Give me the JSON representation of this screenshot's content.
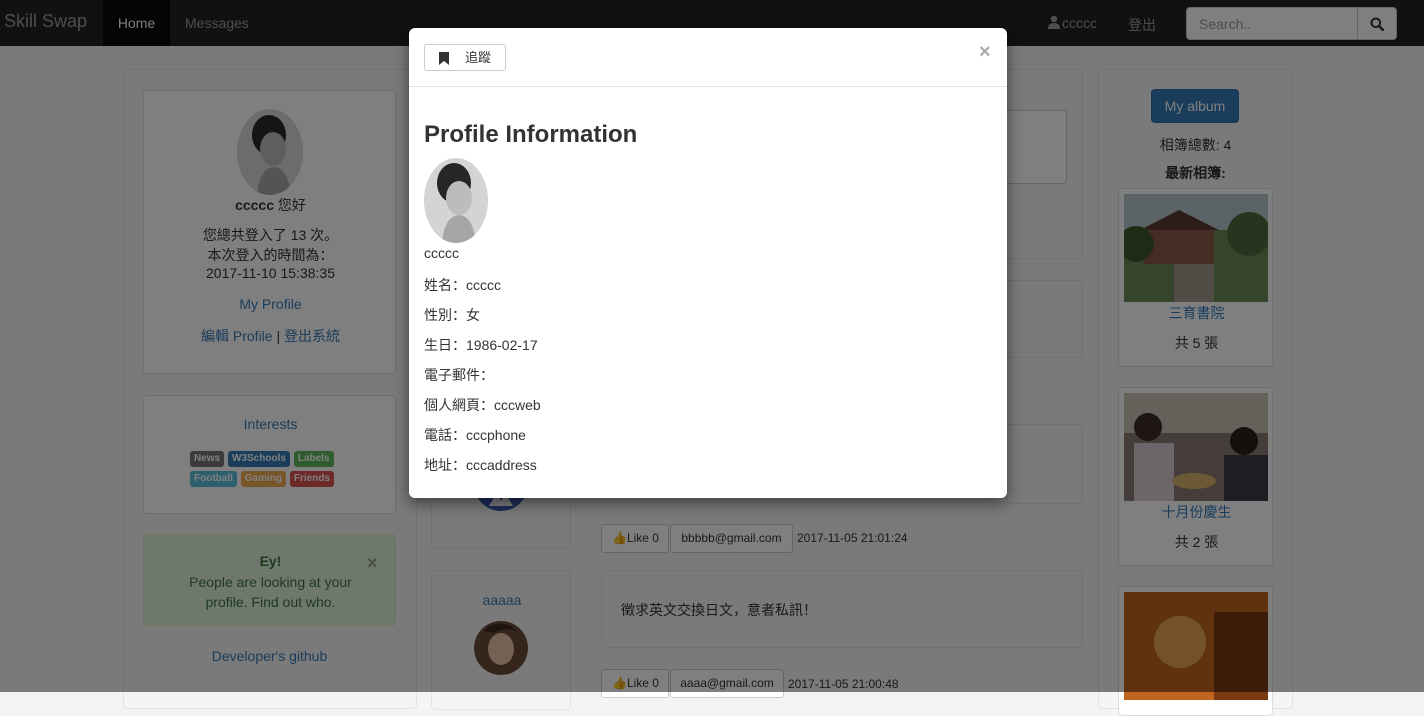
{
  "navbar": {
    "brand": "Skill Swap",
    "home": "Home",
    "messages": "Messages",
    "user": "ccccc",
    "logout": "登出",
    "search_placeholder": "Search.."
  },
  "left": {
    "greeting_name": "ccccc",
    "greeting_suffix": " 您好",
    "login_count": "您總共登入了 13 次。",
    "login_time_label": "本次登入的時間為：",
    "login_time": "2017-11-10 15:38:35",
    "my_profile": "My Profile",
    "edit_profile": "編輯 Profile",
    "separator": "|",
    "logout_system": "登出系統",
    "interests_title": "Interests",
    "tags": [
      {
        "label": "News",
        "color": "#777777"
      },
      {
        "label": "W3Schools",
        "color": "#337ab7"
      },
      {
        "label": "Labels",
        "color": "#5cb85c"
      },
      {
        "label": "Football",
        "color": "#5bc0de"
      },
      {
        "label": "Gaming",
        "color": "#f0ad4e"
      },
      {
        "label": "Friends",
        "color": "#d9534f"
      }
    ],
    "alert_title": "Ey!",
    "alert_text": "People are looking at your profile. Find out who.",
    "alert_close": "×",
    "github": "Developer's github"
  },
  "feed": {
    "posts": [
      {
        "like": "Like 0",
        "email": "bbbbb@gmail.com",
        "time": "2017-11-05 21:01:24"
      },
      {
        "author": "aaaaa",
        "content": "徵求英文交換日文，意者私訊！",
        "like": "Like 0",
        "email": "aaaa@gmail.com",
        "time": "2017-11-05 21:00:48"
      }
    ]
  },
  "right": {
    "album_button": "My album",
    "album_count": "相簿總數: 4",
    "latest": "最新相簿:",
    "albums": [
      {
        "name": "三育書院",
        "count": "共 5 張"
      },
      {
        "name": "十月份慶生",
        "count": "共 2 張"
      }
    ]
  },
  "modal": {
    "follow": "追蹤",
    "close": "×",
    "title": "Profile Information",
    "username": "ccccc",
    "fields": [
      "姓名：ccccc",
      "性別：女",
      "生日：1986-02-17",
      "電子郵件：",
      "個人網頁：cccweb",
      "電話：cccphone",
      "地址：cccaddress"
    ]
  },
  "colors": {
    "navbar": "#222222",
    "primary": "#337ab7",
    "alert_bg": "#dff0d8",
    "alert_text": "#3c763d"
  }
}
